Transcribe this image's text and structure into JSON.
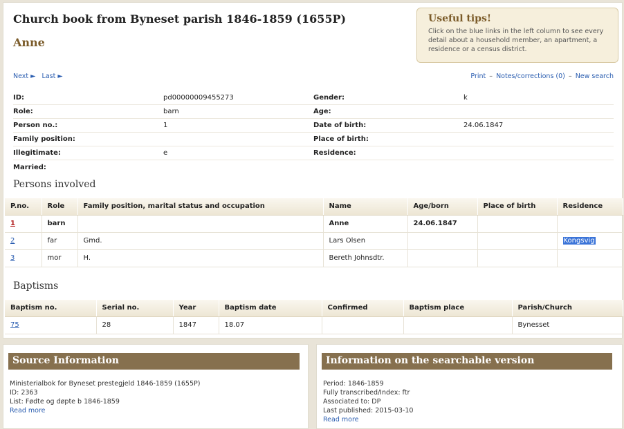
{
  "header": {
    "title": "Church book from Byneset parish 1846-1859 (1655P)",
    "person_name": "Anne"
  },
  "tips": {
    "title": "Useful tips!",
    "text": "Click on the blue links in the left column to see every detail about a household member, an apartment, a residence or a census district."
  },
  "nav": {
    "next": "Next ►",
    "last": "Last ►",
    "print": "Print",
    "notes": "Notes/corrections (0)",
    "new_search": "New search",
    "separator": "–"
  },
  "info": {
    "rows": [
      {
        "k1": "ID:",
        "v1": "pd00000009455273",
        "k2": "Gender:",
        "v2": "k"
      },
      {
        "k1": "Role:",
        "v1": "barn",
        "k2": "Age:",
        "v2": ""
      },
      {
        "k1": "Person no.:",
        "v1": "1",
        "k2": "Date of birth:",
        "v2": "24.06.1847"
      },
      {
        "k1": "Family position:",
        "v1": "",
        "k2": "Place of birth:",
        "v2": ""
      },
      {
        "k1": "Illegitimate:",
        "v1": "e",
        "k2": "Residence:",
        "v2": ""
      },
      {
        "k1": "Married:",
        "v1": "",
        "k2": "",
        "v2": ""
      }
    ]
  },
  "persons": {
    "title": "Persons involved",
    "headers": [
      "P.no.",
      "Role",
      "Family position, marital status and occupation",
      "Name",
      "Age/born",
      "Place of birth",
      "Residence"
    ],
    "rows": [
      {
        "pno": "1",
        "role": "barn",
        "family": "",
        "name": "Anne",
        "age": "24.06.1847",
        "place": "",
        "residence": ""
      },
      {
        "pno": "2",
        "role": "far",
        "family": "Gmd.",
        "name": "Lars Olsen",
        "age": "",
        "place": "",
        "residence": "Kongsvig"
      },
      {
        "pno": "3",
        "role": "mor",
        "family": "H.",
        "name": "Bereth Johnsdtr.",
        "age": "",
        "place": "",
        "residence": ""
      }
    ]
  },
  "baptisms": {
    "title": "Baptisms",
    "headers": [
      "Baptism no.",
      "Serial no.",
      "Year",
      "Baptism date",
      "Confirmed",
      "Baptism place",
      "Parish/Church"
    ],
    "rows": [
      {
        "no": "75",
        "serial": "28",
        "year": "1847",
        "date": "18.07",
        "confirmed": "",
        "place": "",
        "parish": "Bynesset"
      }
    ]
  },
  "source": {
    "title": "Source Information",
    "lines": [
      "Ministerialbok for Byneset prestegjeld 1846-1859 (1655P)",
      "ID: 2363",
      "List: Fødte og døpte b 1846-1859"
    ],
    "read_more": "Read more"
  },
  "searchable": {
    "title": "Information on the searchable version",
    "lines": [
      "Period: 1846-1859",
      "Fully transcribed/Index: ftr",
      "Associated to: DP",
      "Last published: 2015-03-10"
    ],
    "read_more": "Read more"
  }
}
